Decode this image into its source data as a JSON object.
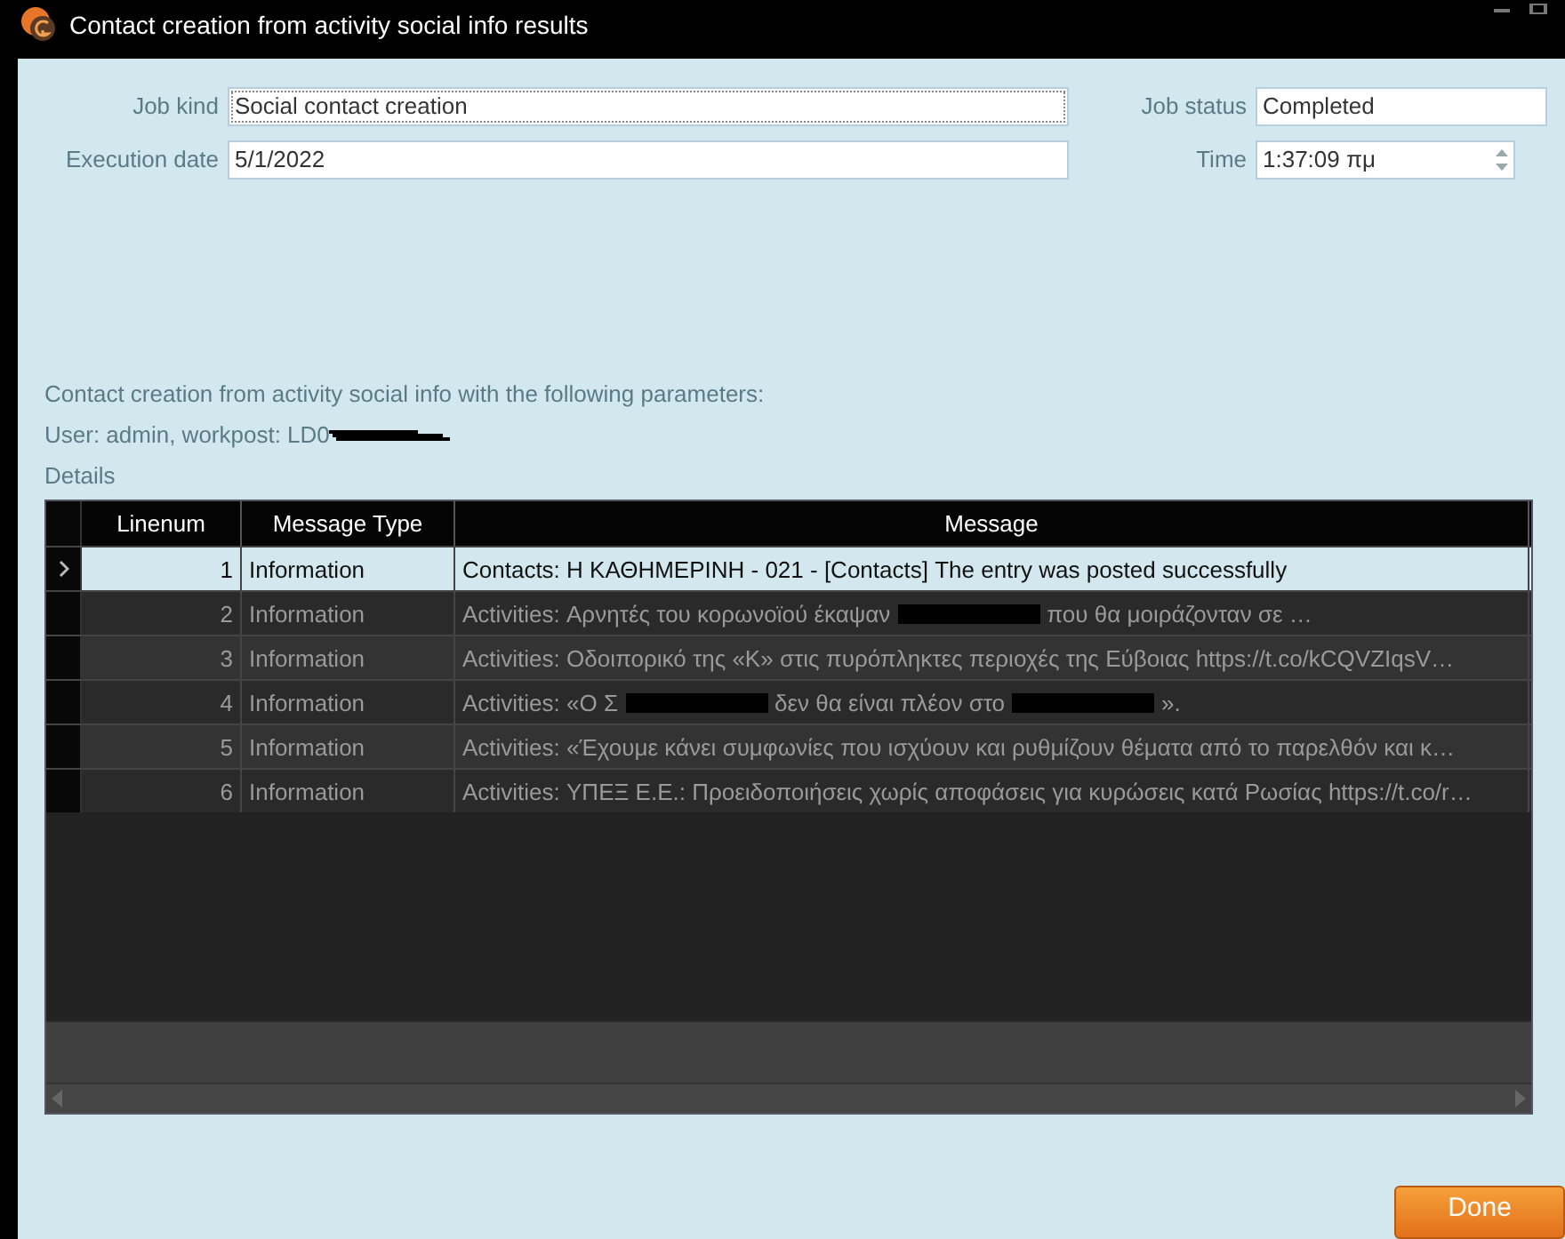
{
  "window": {
    "title": "Contact creation from activity social info results"
  },
  "form": {
    "job_kind": {
      "label": "Job kind",
      "value": "Social contact creation",
      "focused": true
    },
    "execution_date": {
      "label": "Execution date",
      "value": "5/1/2022"
    },
    "job_status": {
      "label": "Job status",
      "value": "Completed"
    },
    "time": {
      "label": "Time",
      "value": "1:37:09 πμ"
    }
  },
  "info": {
    "parameters_line": "Contact creation from activity social info with the following parameters:",
    "user_line": "User: admin, workpost: LD0",
    "details_label": "Details"
  },
  "table": {
    "columns": [
      "Linenum",
      "Message Type",
      "Message"
    ],
    "rows": [
      {
        "linenum": "1",
        "type": "Information",
        "message": [
          "Contacts: Η ΚΑΘΗΜΕΡΙΝΗ - 021 - [Contacts] The entry was posted successfully"
        ],
        "selected": true
      },
      {
        "linenum": "2",
        "type": "Information",
        "message": [
          "Activities: Αρνητές του κορωνοϊού έκαψαν",
          "που θα μοιράζονταν σε …"
        ],
        "selected": false
      },
      {
        "linenum": "3",
        "type": "Information",
        "message": [
          "Activities: Οδοιπορικό της «Κ» στις πυρόπληκτες περιοχές της Εύβοιας https://t.co/kCQVZIqsV…"
        ],
        "selected": false
      },
      {
        "linenum": "4",
        "type": "Information",
        "message": [
          "Activities: «Ο Σ",
          "δεν θα είναι πλέον στο",
          "»."
        ],
        "selected": false
      },
      {
        "linenum": "5",
        "type": "Information",
        "message": [
          "Activities: «Έχουμε κάνει συμφωνίες που ισχύουν και ρυθμίζουν θέματα από το παρελθόν και κ…"
        ],
        "selected": false
      },
      {
        "linenum": "6",
        "type": "Information",
        "message": [
          "Activities: ΥΠΕΞ Ε.Ε.: Προειδοποιήσεις χωρίς αποφάσεις για κυρώσεις κατά Ρωσίας https://t.co/r…"
        ],
        "selected": false
      }
    ]
  },
  "buttons": [
    {
      "label": "Done"
    }
  ]
}
